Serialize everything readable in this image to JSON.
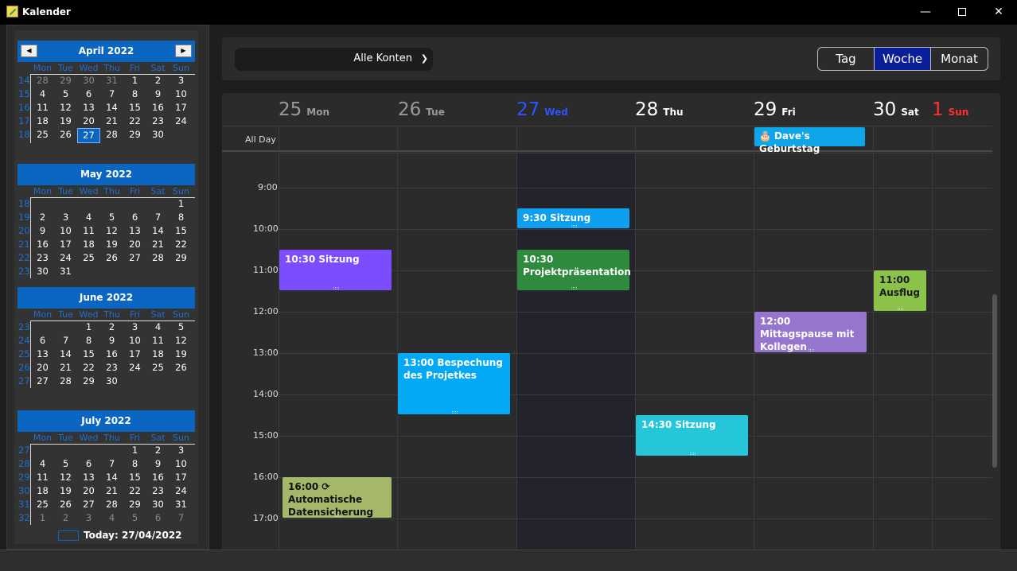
{
  "window": {
    "title": "Kalender",
    "min_icon": "minimize-icon",
    "max_icon": "maximize-icon",
    "close_icon": "close-icon"
  },
  "sidebar": {
    "dow": [
      "Mon",
      "Tue",
      "Wed",
      "Thu",
      "Fri",
      "Sat",
      "Sun"
    ],
    "months": [
      {
        "name": "April 2022",
        "weeks": [
          {
            "wk": "14",
            "days": [
              "28",
              "29",
              "30",
              "31",
              "1",
              "2",
              "3"
            ],
            "dim": [
              0,
              1,
              2,
              3
            ]
          },
          {
            "wk": "15",
            "days": [
              "4",
              "5",
              "6",
              "7",
              "8",
              "9",
              "10"
            ],
            "dim": []
          },
          {
            "wk": "16",
            "days": [
              "11",
              "12",
              "13",
              "14",
              "15",
              "16",
              "17"
            ],
            "dim": []
          },
          {
            "wk": "17",
            "days": [
              "18",
              "19",
              "20",
              "21",
              "22",
              "23",
              "24"
            ],
            "dim": []
          },
          {
            "wk": "18",
            "days": [
              "25",
              "26",
              "27",
              "28",
              "29",
              "30",
              ""
            ],
            "dim": [],
            "sel": 2
          }
        ]
      },
      {
        "name": "May 2022",
        "weeks": [
          {
            "wk": "18",
            "days": [
              "",
              "",
              "",
              "",
              "",
              "",
              "1"
            ],
            "dim": []
          },
          {
            "wk": "19",
            "days": [
              "2",
              "3",
              "4",
              "5",
              "6",
              "7",
              "8"
            ],
            "dim": []
          },
          {
            "wk": "20",
            "days": [
              "9",
              "10",
              "11",
              "12",
              "13",
              "14",
              "15"
            ],
            "dim": []
          },
          {
            "wk": "21",
            "days": [
              "16",
              "17",
              "18",
              "19",
              "20",
              "21",
              "22"
            ],
            "dim": []
          },
          {
            "wk": "22",
            "days": [
              "23",
              "24",
              "25",
              "26",
              "27",
              "28",
              "29"
            ],
            "dim": []
          },
          {
            "wk": "23",
            "days": [
              "30",
              "31",
              "",
              "",
              "",
              "",
              ""
            ],
            "dim": []
          }
        ]
      },
      {
        "name": "June 2022",
        "weeks": [
          {
            "wk": "23",
            "days": [
              "",
              "",
              "1",
              "2",
              "3",
              "4",
              "5"
            ],
            "dim": []
          },
          {
            "wk": "24",
            "days": [
              "6",
              "7",
              "8",
              "9",
              "10",
              "11",
              "12"
            ],
            "dim": []
          },
          {
            "wk": "25",
            "days": [
              "13",
              "14",
              "15",
              "16",
              "17",
              "18",
              "19"
            ],
            "dim": []
          },
          {
            "wk": "26",
            "days": [
              "20",
              "21",
              "22",
              "23",
              "24",
              "25",
              "26"
            ],
            "dim": []
          },
          {
            "wk": "27",
            "days": [
              "27",
              "28",
              "29",
              "30",
              "",
              "",
              ""
            ],
            "dim": []
          }
        ]
      },
      {
        "name": "July 2022",
        "weeks": [
          {
            "wk": "27",
            "days": [
              "",
              "",
              "",
              "",
              "1",
              "2",
              "3"
            ],
            "dim": []
          },
          {
            "wk": "28",
            "days": [
              "4",
              "5",
              "6",
              "7",
              "8",
              "9",
              "10"
            ],
            "dim": []
          },
          {
            "wk": "29",
            "days": [
              "11",
              "12",
              "13",
              "14",
              "15",
              "16",
              "17"
            ],
            "dim": []
          },
          {
            "wk": "30",
            "days": [
              "18",
              "19",
              "20",
              "21",
              "22",
              "23",
              "24"
            ],
            "dim": []
          },
          {
            "wk": "31",
            "days": [
              "25",
              "26",
              "27",
              "28",
              "29",
              "30",
              "31"
            ],
            "dim": []
          },
          {
            "wk": "32",
            "days": [
              "1",
              "2",
              "3",
              "4",
              "5",
              "6",
              "7"
            ],
            "dim": [
              0,
              1,
              2,
              3,
              4,
              5,
              6
            ]
          }
        ]
      }
    ],
    "today_label": "Today: 27/04/2022"
  },
  "toolbar": {
    "account_select": "Alle Konten",
    "views": [
      "Tag",
      "Woche",
      "Monat"
    ],
    "active_view": "Woche"
  },
  "week": {
    "days": [
      {
        "num": "25",
        "name": "Mon",
        "color": "#9a9a9a"
      },
      {
        "num": "26",
        "name": "Tue",
        "color": "#9a9a9a"
      },
      {
        "num": "27",
        "name": "Wed",
        "color": "#2f54ff"
      },
      {
        "num": "28",
        "name": "Thu",
        "color": "#ffffff"
      },
      {
        "num": "29",
        "name": "Fri",
        "color": "#ffffff"
      },
      {
        "num": "30",
        "name": "Sat",
        "color": "#ffffff"
      },
      {
        "num": "1",
        "name": "Sun",
        "color": "#ff3030"
      }
    ],
    "all_day_label": "All Day",
    "hours": [
      "9:00",
      "10:00",
      "11:00",
      "12:00",
      "13:00",
      "14:00",
      "15:00",
      "16:00",
      "17:00"
    ],
    "allday_events": [
      {
        "title": "Dave's Geburtstag",
        "day": 4,
        "color": "#0ea5e9",
        "icon": "cake-icon"
      }
    ],
    "events": [
      {
        "title": "9:30 Sitzung",
        "day": 2,
        "start": 9.5,
        "end": 10.0,
        "color": "#0ea0f0",
        "text": "#ffffff"
      },
      {
        "title": "10:30 Sitzung",
        "day": 0,
        "start": 10.5,
        "end": 11.5,
        "color": "#7c4dff",
        "text": "#ffffff"
      },
      {
        "title": "10:30 Projektpräsentation",
        "day": 2,
        "start": 10.5,
        "end": 11.5,
        "color": "#2e8b3e",
        "text": "#ffffff"
      },
      {
        "title": "11:00 Ausflug",
        "day": 5,
        "start": 11.0,
        "end": 12.0,
        "color": "#8bc34a",
        "text": "#1a1a1a"
      },
      {
        "title": "12:00 Mittagspause mit Kollegen",
        "day": 4,
        "start": 12.0,
        "end": 13.0,
        "color": "#9575cd",
        "text": "#ffffff"
      },
      {
        "title": "13:00 Bespechung des Projetkes",
        "day": 1,
        "start": 13.0,
        "end": 14.5,
        "color": "#03a9f4",
        "text": "#ffffff"
      },
      {
        "title": "14:30 Sitzung",
        "day": 3,
        "start": 14.5,
        "end": 15.5,
        "color": "#26c6da",
        "text": "#ffffff"
      },
      {
        "title": "16:00 ⟳ Automatische Datensicherung",
        "day": 0,
        "start": 16.0,
        "end": 17.0,
        "color": "#a5b86a",
        "text": "#111111"
      }
    ]
  }
}
